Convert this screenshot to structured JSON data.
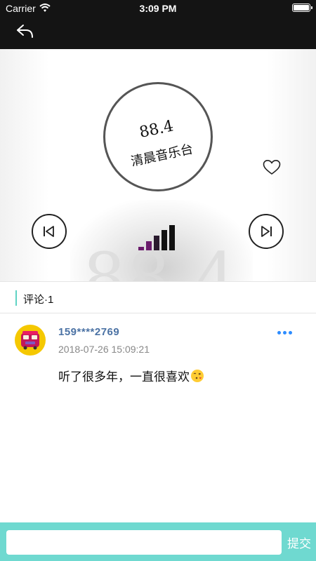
{
  "status_bar": {
    "carrier": "Carrier",
    "time": "3:09 PM",
    "icons": [
      "wifi-icon",
      "battery-icon"
    ]
  },
  "nav": {
    "back_icon": "back-arrow-icon"
  },
  "player": {
    "frequency": "88.4",
    "station_name": "清晨音乐台",
    "watermark": "88.4",
    "icons": [
      "heart-icon",
      "previous-track-icon",
      "next-track-icon",
      "signal-bars-icon"
    ],
    "signal_color": "#6a1b6b"
  },
  "comments": {
    "title": "评论·1",
    "accent_color": "#5fd3c4",
    "items": [
      {
        "user": "159****2769",
        "time": "2018-07-26 15:09:21",
        "text": "听了很多年，一直很喜欢",
        "icons": [
          "bus-avatar-icon",
          "kiss-emoji-icon",
          "more-dots-icon"
        ]
      }
    ]
  },
  "input_bar": {
    "placeholder": "",
    "submit_label": "提交",
    "background_color": "#6fd9d0"
  }
}
